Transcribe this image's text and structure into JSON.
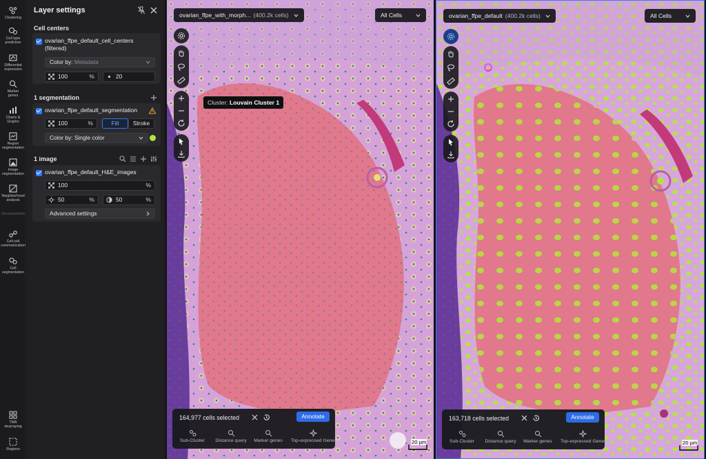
{
  "rail": {
    "items": [
      {
        "label": "Clustering",
        "icon": "clustering-icon"
      },
      {
        "label": "Cell type\nprediction",
        "icon": "cell-type-prediction-icon"
      },
      {
        "label": "Differential\nexpression",
        "icon": "differential-expression-icon"
      },
      {
        "label": "Marker\ngenes",
        "icon": "marker-genes-icon"
      },
      {
        "label": "Charts &\nGraphs",
        "icon": "charts-icon"
      },
      {
        "label": "Region\nsegmentation",
        "icon": "region-segmentation-icon"
      },
      {
        "label": "Image\nsegmentation",
        "icon": "image-segmentation-icon"
      },
      {
        "label": "Neighborhood\nanalysis",
        "icon": "neighborhood-analysis-icon"
      },
      {
        "label": "Deconvolution",
        "icon": "deconvolution-icon"
      },
      {
        "label": "Cell-cell\ncommunication",
        "icon": "cell-cell-communication-icon"
      },
      {
        "label": "Cell\nsegmentation",
        "icon": "cell-segmentation-icon"
      },
      {
        "label": "TMA\ndearraying",
        "icon": "tma-dearraying-icon"
      },
      {
        "label": "Regions",
        "icon": "regions-icon"
      }
    ]
  },
  "panel": {
    "title": "Layer settings",
    "cell_centers": {
      "section_title": "Cell centers",
      "layer_name": "ovarian_ffpe_default_cell_centers\n(filtered)",
      "color_by_label": "Color by:",
      "color_by_value": "Metadata",
      "opacity": "100",
      "opacity_unit": "%",
      "point_size": "20"
    },
    "segmentation": {
      "section_title": "1 segmentation",
      "layer_name": "ovarian_ffpe_default_segmentation",
      "opacity": "100",
      "opacity_unit": "%",
      "fill_label": "Fill",
      "stroke_label": "Stroke",
      "color_by_label": "Color by:",
      "color_by_value": "Single color",
      "swatch_color": "#b3e63a"
    },
    "image": {
      "section_title": "1 image",
      "layer_name": "ovarian_ffpe_default_H&E_images",
      "opacity": "100",
      "opacity_unit": "%",
      "brightness": "50",
      "brightness_unit": "%",
      "contrast": "50",
      "contrast_unit": "%",
      "advanced_label": "Advanced settings"
    }
  },
  "viewer_left": {
    "dataset": "ovarian_ffpe_with_morph...",
    "cell_count": "(400.2k cells)",
    "filter": "All Cells",
    "tooltip_prefix": "Cluster:",
    "tooltip_value": "Louvain Cluster 1",
    "selected_text": "164,977 cells selected",
    "annotate": "Annotate",
    "actions": [
      "Sub-Cluster",
      "Distance query",
      "Marker genes",
      "Top-expressed Genes"
    ],
    "scale": "20 µm"
  },
  "viewer_right": {
    "dataset": "ovarian_ffpe_default",
    "cell_count": "(400.2k cells)",
    "filter": "All Cells",
    "selected_text": "163,718 cells selected",
    "annotate": "Annotate",
    "actions": [
      "Sub-Cluster",
      "Distance query",
      "Marker genes",
      "Top-expressed Genes"
    ],
    "scale": "20 µm"
  },
  "colors": {
    "accent": "#2f7cf6",
    "annotate": "#2e6be6",
    "cluster_fill": "#e1788c",
    "segmentation": "#b3e63a",
    "tissue": "#d9a9de"
  }
}
